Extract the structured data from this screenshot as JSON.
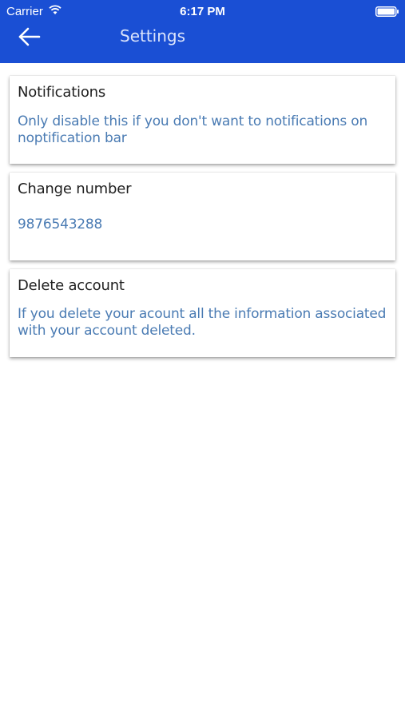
{
  "status_bar": {
    "carrier": "Carrier",
    "time": "6:17 PM",
    "icons": [
      "wifi-icon",
      "battery-icon"
    ]
  },
  "header": {
    "title": "Settings",
    "back_icon": "arrow-left-icon",
    "background_color": "#1a4fd4"
  },
  "settings": [
    {
      "title": "Notifications",
      "description": "Only disable this if you don't want to notifications  on noptification bar"
    },
    {
      "title": "Change number",
      "description": "9876543288"
    },
    {
      "title": "Delete account",
      "description": "If you delete your acount all the information associated with your account deleted."
    }
  ],
  "colors": {
    "accent_text": "#4a7bb3",
    "title_text": "#1f1f1f"
  }
}
